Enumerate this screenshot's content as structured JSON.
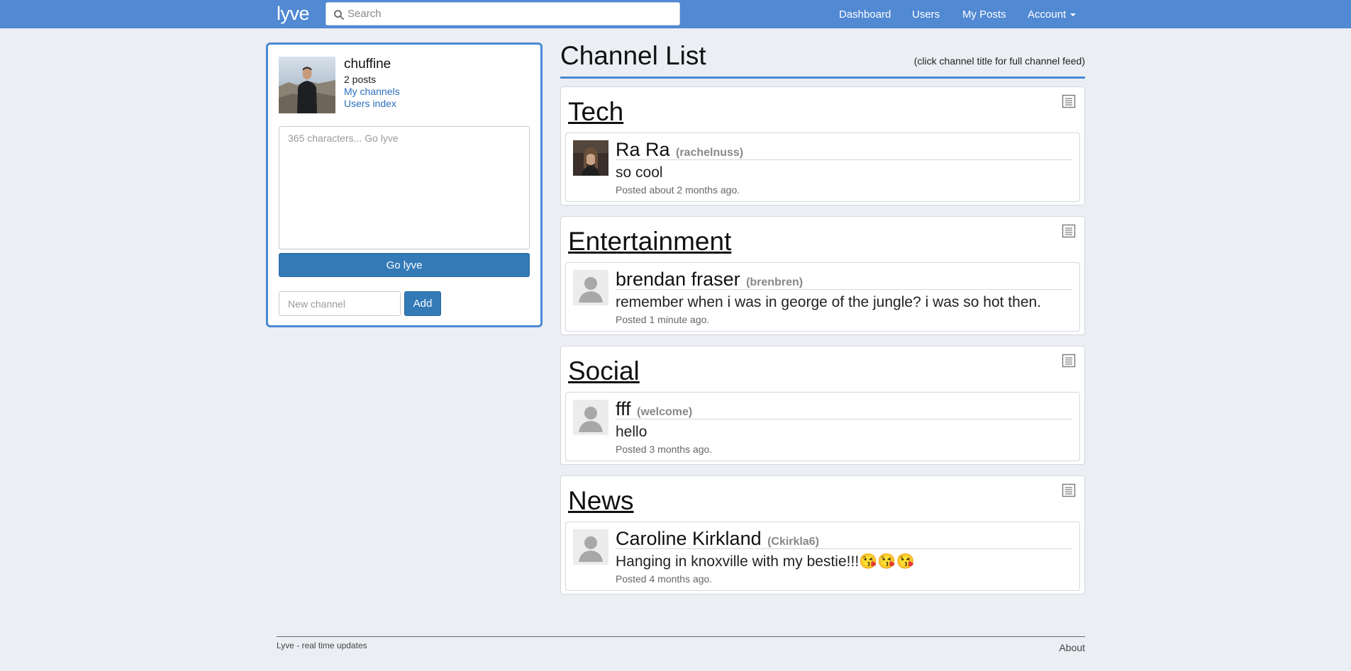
{
  "navbar": {
    "brand": "lyve",
    "search_placeholder": "Search",
    "links": [
      "Dashboard",
      "Users",
      "My Posts",
      "Account"
    ],
    "color": "#5189d2"
  },
  "profile": {
    "username": "chuffine",
    "post_count": "2 posts",
    "my_channels": "My channels",
    "users_index": "Users index"
  },
  "composer": {
    "placeholder": "365 characters... Go lyve",
    "submit_label": "Go lyve",
    "new_channel_placeholder": "New channel",
    "add_label": "Add",
    "accent": "#337ab7"
  },
  "main": {
    "title": "Channel List",
    "hint": "(click channel title for full channel feed)"
  },
  "channels": [
    {
      "title": "Tech",
      "post": {
        "author": "Ra Ra",
        "handle": "(rachelnuss)",
        "body": "so cool",
        "time": "Posted about 2 months ago.",
        "avatar": "photo"
      }
    },
    {
      "title": "Entertainment",
      "post": {
        "author": "brendan fraser",
        "handle": "(brenbren)",
        "body": "remember when i was in george of the jungle? i was so hot then.",
        "time": "Posted 1 minute ago.",
        "avatar": "default"
      }
    },
    {
      "title": "Social",
      "post": {
        "author": "fff",
        "handle": "(welcome)",
        "body": "hello",
        "time": "Posted 3 months ago.",
        "avatar": "default"
      }
    },
    {
      "title": "News",
      "post": {
        "author": "Caroline Kirkland",
        "handle": "(Ckirkla6)",
        "body": "Hanging in knoxville with my bestie!!!😘😘😘",
        "time": "Posted 4 months ago.",
        "avatar": "default"
      }
    }
  ],
  "footer": {
    "tagline": "Lyve - real time updates",
    "about": "About"
  }
}
